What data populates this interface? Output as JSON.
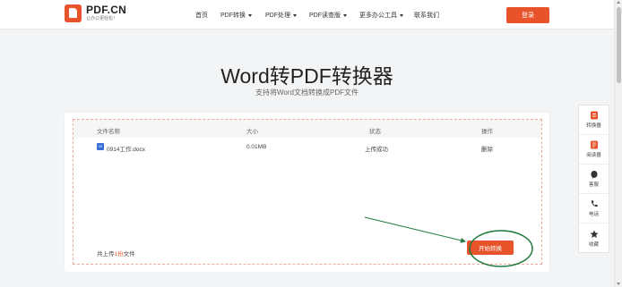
{
  "header": {
    "logo": {
      "name": "PDF.CN",
      "slogan": "让办公更轻松！"
    },
    "nav": [
      {
        "label": "首页",
        "dropdown": false
      },
      {
        "label": "PDF转换",
        "dropdown": true
      },
      {
        "label": "PDF处理",
        "dropdown": true
      },
      {
        "label": "PDF读查版",
        "dropdown": true
      },
      {
        "label": "更多办公工具",
        "dropdown": true
      },
      {
        "label": "联系我们",
        "dropdown": false
      }
    ],
    "login_label": "登录"
  },
  "hero": {
    "title": "Word转PDF转换器",
    "subtitle": "支持将Word文档转换成PDF文件"
  },
  "table": {
    "headers": [
      "文件名称",
      "大小",
      "状态",
      "操作"
    ],
    "rows": [
      {
        "file_name": "0914工作.docx",
        "size": "0.01MB",
        "status": "上传成功",
        "action": "删除"
      }
    ]
  },
  "footer": {
    "prefix": "共上传",
    "count": "1份",
    "suffix": "文件",
    "start_label": "开始转换"
  },
  "side_tools": [
    {
      "label": "转换器",
      "icon": "converter-icon"
    },
    {
      "label": "阅读器",
      "icon": "reader-icon"
    },
    {
      "label": "客服",
      "icon": "customer-service-icon"
    },
    {
      "label": "电话",
      "icon": "phone-icon"
    },
    {
      "label": "收藏",
      "icon": "star-icon"
    }
  ],
  "colors": {
    "accent": "#e8532b",
    "annotation": "#1e7a3c",
    "file_icon": "#3a6fd8"
  }
}
